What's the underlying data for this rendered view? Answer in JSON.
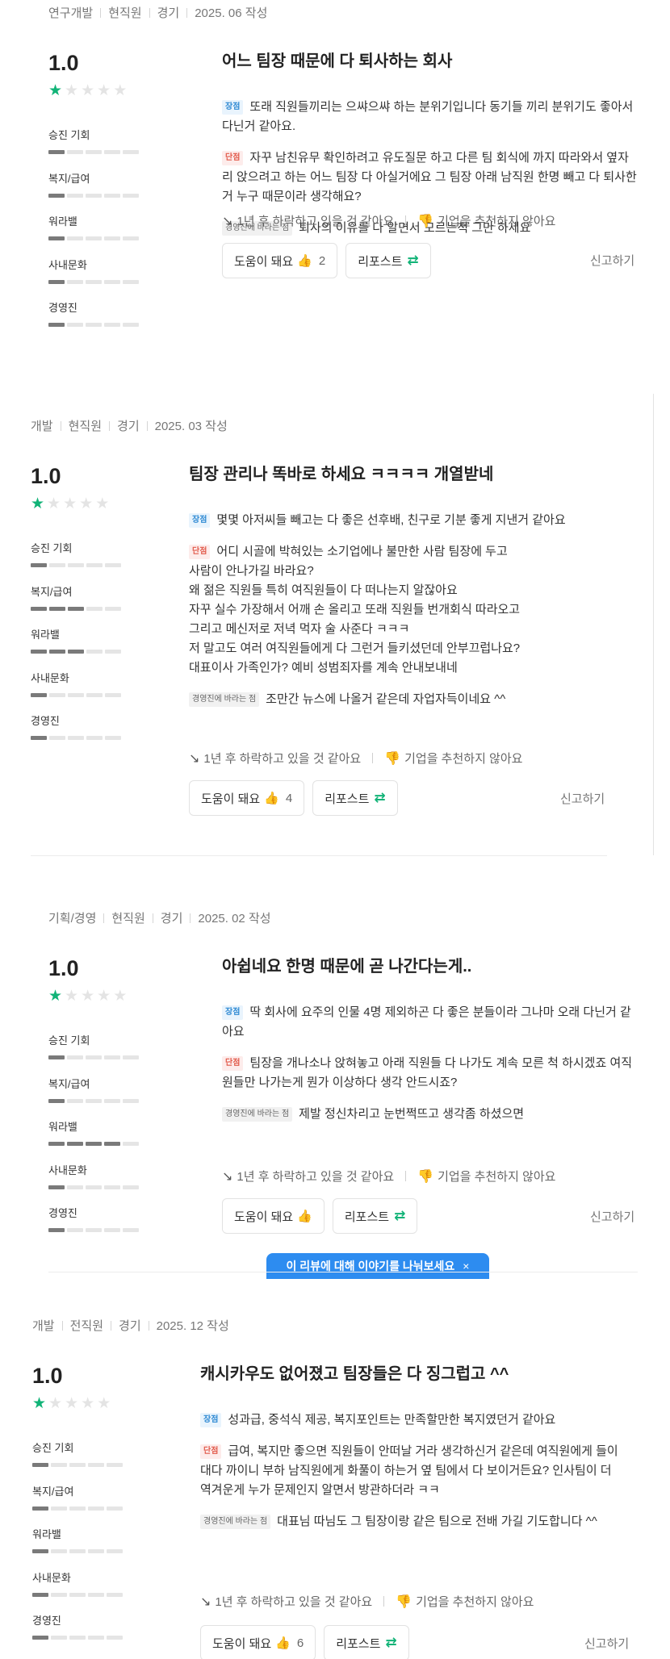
{
  "reviews": [
    {
      "meta": [
        "연구개발",
        "현직원",
        "경기",
        "2025. 06 작성"
      ],
      "score": "1.0",
      "stars": 1,
      "categories": [
        {
          "label": "승진 기회",
          "level": 1
        },
        {
          "label": "복지/급여",
          "level": 1
        },
        {
          "label": "워라밸",
          "level": 1
        },
        {
          "label": "사내문화",
          "level": 1
        },
        {
          "label": "경영진",
          "level": 1
        }
      ],
      "title": "어느 팀장 때문에 다 퇴사하는 회사",
      "pros": "또래 직원들끼리는 으쌰으쌰 하는 분위기입니다 동기들 끼리 분위기도 좋아서 다닌거 같아요.",
      "cons": "자꾸 남친유무 확인하려고 유도질문 하고 다른 팀 회식에 까지 따라와서 옆자리 앉으려고 하는 어느 팀장 다 아실거에요 그 팀장 아래 남직원 한명 빼고 다 퇴사한거 누구 때문이라 생각해요?",
      "management": "퇴사의 이유를 다 알면서 모르는척 그만 하세요",
      "outlook": "1년 후 하락하고 있을 것 같아요",
      "recommend": "기업을 추천하지 않아요",
      "helpful_label": "도움이 돼요",
      "helpful_count": "2",
      "repost_label": "리포스트",
      "report_label": "신고하기"
    },
    {
      "meta": [
        "개발",
        "현직원",
        "경기",
        "2025. 03 작성"
      ],
      "score": "1.0",
      "stars": 1,
      "categories": [
        {
          "label": "승진 기회",
          "level": 1
        },
        {
          "label": "복지/급여",
          "level": 3
        },
        {
          "label": "워라밸",
          "level": 3
        },
        {
          "label": "사내문화",
          "level": 1
        },
        {
          "label": "경영진",
          "level": 1
        }
      ],
      "title": "팀장 관리나 똑바로 하세요 ㅋㅋㅋㅋ 개열받네",
      "pros": "몇몇 아저씨들 빼고는 다 좋은 선후배, 친구로 기분 좋게 지낸거 같아요",
      "cons": "어디 시골에 박혀있는 소기업에나 불만한 사람 팀장에 두고\n사람이 안나가길 바라요?\n왜 젊은 직원들 특히 여직원들이 다 떠나는지 알잖아요\n자꾸 실수 가장해서 어깨 손 올리고 또래 직원들 번개회식 따라오고\n그리고 메신저로 저녁 먹자 술 사준다 ㅋㅋㅋ\n저 말고도 여러 여직원들에게 다 그런거 들키셨던데 안부끄럽나요?\n대표이사 가족인가? 예비 성범죄자를 계속 안내보내네",
      "management": "조만간 뉴스에 나올거 같은데 자업자득이네요 ^^",
      "outlook": "1년 후 하락하고 있을 것 같아요",
      "recommend": "기업을 추천하지 않아요",
      "helpful_label": "도움이 돼요",
      "helpful_count": "4",
      "repost_label": "리포스트",
      "report_label": "신고하기"
    },
    {
      "meta": [
        "기획/경영",
        "현직원",
        "경기",
        "2025. 02 작성"
      ],
      "score": "1.0",
      "stars": 1,
      "categories": [
        {
          "label": "승진 기회",
          "level": 1
        },
        {
          "label": "복지/급여",
          "level": 1
        },
        {
          "label": "워라밸",
          "level": 4
        },
        {
          "label": "사내문화",
          "level": 1
        },
        {
          "label": "경영진",
          "level": 1
        }
      ],
      "title": "아쉽네요 한명 때문에 곧 나간다는게..",
      "pros": "딱 회사에 요주의 인물 4명 제외하곤 다 좋은 분들이라 그나마 오래 다닌거 같아요",
      "cons": "팀장을 개나소나 앉혀놓고 아래 직원들 다 나가도 계속 모른 척 하시겠죠 여직원들만 나가는게 뭔가 이상하다 생각 안드시죠?",
      "management": "제발 정신차리고 눈번쩍뜨고 생각좀 하셨으면",
      "outlook": "1년 후 하락하고 있을 것 같아요",
      "recommend": "기업을 추천하지 않아요",
      "helpful_label": "도움이 돼요",
      "helpful_count": "",
      "repost_label": "리포스트",
      "report_label": "신고하기"
    },
    {
      "meta": [
        "개발",
        "전직원",
        "경기",
        "2025. 12 작성"
      ],
      "score": "1.0",
      "stars": 1,
      "categories": [
        {
          "label": "승진 기회",
          "level": 1
        },
        {
          "label": "복지/급여",
          "level": 1
        },
        {
          "label": "워라밸",
          "level": 1
        },
        {
          "label": "사내문화",
          "level": 1
        },
        {
          "label": "경영진",
          "level": 1
        }
      ],
      "title": "캐시카우도 없어졌고 팀장들은 다 징그럽고 ^^",
      "pros": "성과급, 중석식 제공, 복지포인트는 만족할만한 복지였던거 같아요",
      "cons": "급여, 복지만 좋으면 직원들이 안떠날 거라 생각하신거 같은데 여직원에게 들이대다 까이니 부하 남직원에게 화풀이 하는거 옆 팀에서 다 보이거든요? 인사팀이 더 역겨운게 누가 문제인지 알면서 방관하더라 ㅋㅋ",
      "management": "대표님 따님도 그 팀장이랑 같은 팀으로 전배 가길 기도합니다 ^^",
      "outlook": "1년 후 하락하고 있을 것 같아요",
      "recommend": "기업을 추천하지 않아요",
      "helpful_label": "도움이 돼요",
      "helpful_count": "6",
      "repost_label": "리포스트",
      "report_label": "신고하기"
    }
  ],
  "labels": {
    "pros": "장점",
    "cons": "단점",
    "management": "경영진에 바라는 점"
  },
  "tooltip": {
    "text": "이 리뷰에 대해 이야기를 나눠보세요",
    "close": "×"
  },
  "icons": {
    "trend": "trend-down-icon",
    "recommend": "thumbs-down-icon",
    "helpful": "thumbs-up-icon",
    "repost": "repost-icon"
  },
  "colors": {
    "star_on": "#11b377",
    "pros_tag": "#2f8ad3",
    "cons_tag": "#e25b4c",
    "tooltip_bg": "#2d8cf0"
  }
}
